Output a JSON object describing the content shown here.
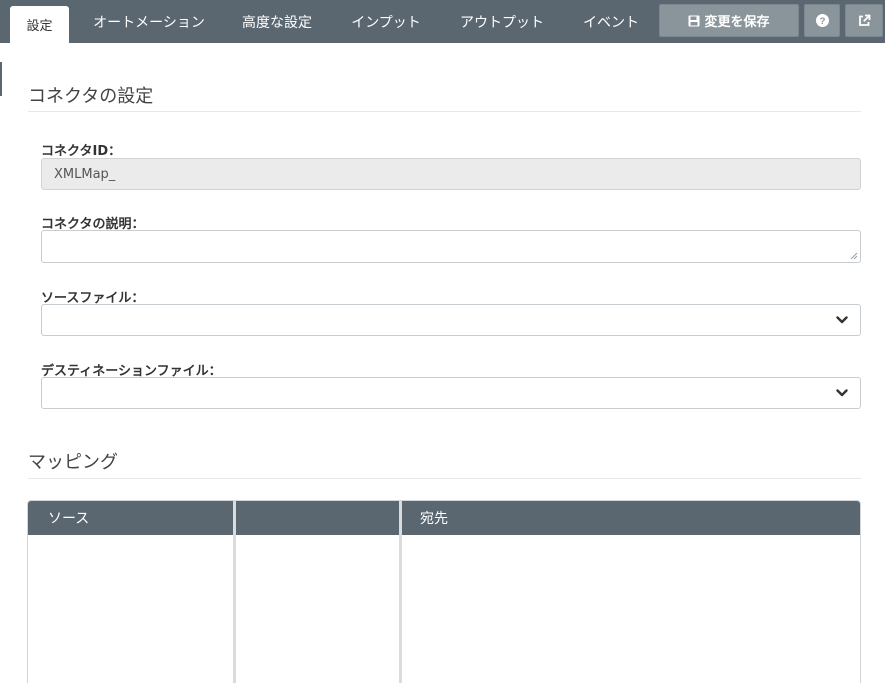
{
  "tabs": [
    {
      "label": "設定",
      "active": true
    },
    {
      "label": "オートメーション",
      "active": false
    },
    {
      "label": "高度な設定",
      "active": false
    },
    {
      "label": "インプット",
      "active": false
    },
    {
      "label": "アウトプット",
      "active": false
    },
    {
      "label": "イベント",
      "active": false
    }
  ],
  "toolbar": {
    "save_label": "変更を保存",
    "save_icon": "floppy-disk-icon",
    "help_icon": "question-circle-icon",
    "external_icon": "external-link-icon"
  },
  "connector_settings": {
    "title": "コネクタの設定",
    "connector_id": {
      "label": "コネクタID：",
      "value": "XMLMap_"
    },
    "description": {
      "label": "コネクタの説明：",
      "value": ""
    },
    "source_file": {
      "label": "ソースファイル：",
      "value": ""
    },
    "destination_file": {
      "label": "デスティネーションファイル：",
      "value": ""
    }
  },
  "mapping": {
    "title": "マッピング",
    "columns": [
      {
        "label": "ソース"
      },
      {
        "label": ""
      },
      {
        "label": "宛先"
      }
    ]
  },
  "colors": {
    "header_bg": "#5b6770",
    "button_bg": "#8a949b",
    "readonly_bg": "#ebebeb"
  }
}
